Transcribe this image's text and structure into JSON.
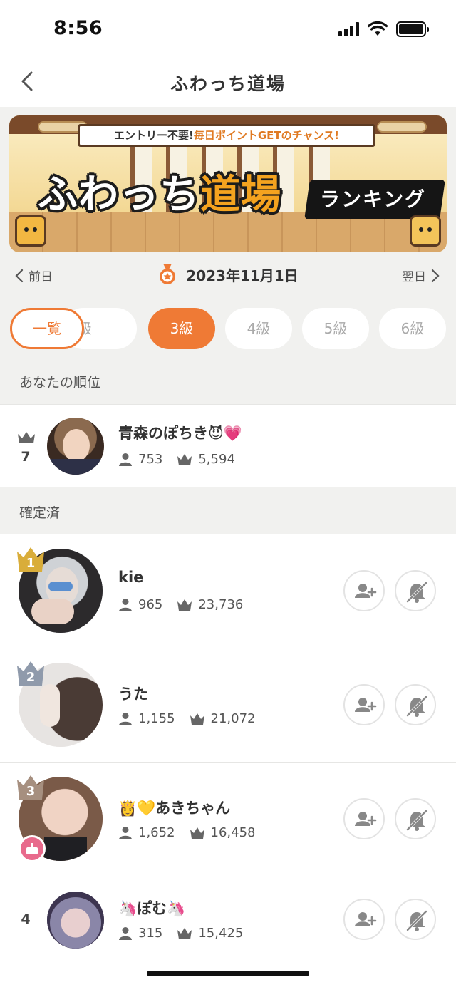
{
  "status_bar": {
    "time": "8:56"
  },
  "nav": {
    "title": "ふわっち道場"
  },
  "banner": {
    "tagline_a": "エントリー不要!",
    "tagline_b": "毎日ポイントGETのチャンス!",
    "headline_a": "ふわっち",
    "headline_b": "道場",
    "subhead": "ランキング"
  },
  "date_nav": {
    "prev_label": "前日",
    "date": "2023年11月1日",
    "next_label": "翌日"
  },
  "tabs": [
    {
      "label": "一覧",
      "state": "outlined"
    },
    {
      "label": "2級",
      "state": "normal"
    },
    {
      "label": "3級",
      "state": "selected"
    },
    {
      "label": "4級",
      "state": "normal"
    },
    {
      "label": "5級",
      "state": "normal"
    },
    {
      "label": "6級",
      "state": "normal"
    }
  ],
  "your_rank": {
    "section_label": "あなたの順位",
    "rank": "7",
    "name": "青森のぽちき😈💗",
    "followers": "753",
    "points": "5,594"
  },
  "confirmed": {
    "section_label": "確定済",
    "entries": [
      {
        "rank": "1",
        "name": "kie",
        "followers": "965",
        "points": "23,736"
      },
      {
        "rank": "2",
        "name": "うた",
        "followers": "1,155",
        "points": "21,072"
      },
      {
        "rank": "3",
        "name": "👸💛あきちゃん",
        "followers": "1,652",
        "points": "16,458"
      },
      {
        "rank": "4",
        "name": "🦄ぽむ🦄",
        "followers": "315",
        "points": "15,425"
      }
    ]
  },
  "colors": {
    "accent": "#ef7a35",
    "gold": "#d9ad3a",
    "silver": "#8f9aab",
    "bronze": "#a68f7f",
    "background_gray": "#f1f1ef"
  },
  "icons": {
    "back": "chevron-left-icon",
    "medal": "medal-icon",
    "follow": "add-user-icon",
    "mute": "bell-off-icon"
  }
}
